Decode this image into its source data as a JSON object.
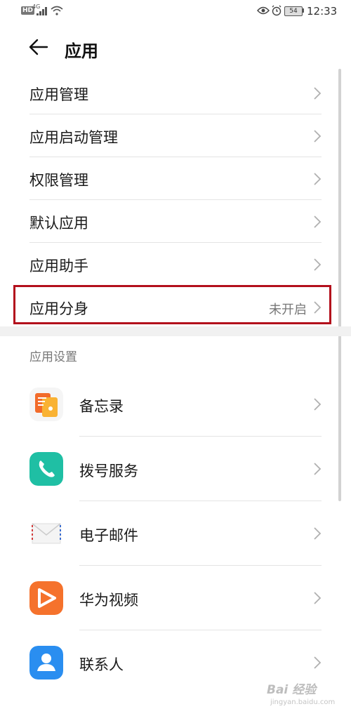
{
  "status": {
    "hd": "HD",
    "network": "4G",
    "battery": "54",
    "time": "12:33"
  },
  "header": {
    "title": "应用"
  },
  "menu": [
    {
      "label": "应用管理",
      "value": ""
    },
    {
      "label": "应用启动管理",
      "value": ""
    },
    {
      "label": "权限管理",
      "value": ""
    },
    {
      "label": "默认应用",
      "value": ""
    },
    {
      "label": "应用助手",
      "value": ""
    },
    {
      "label": "应用分身",
      "value": "未开启"
    }
  ],
  "section_title": "应用设置",
  "apps": [
    {
      "label": "备忘录",
      "icon": "memo-icon"
    },
    {
      "label": "拨号服务",
      "icon": "phone-icon"
    },
    {
      "label": "电子邮件",
      "icon": "email-icon"
    },
    {
      "label": "华为视频",
      "icon": "video-icon"
    },
    {
      "label": "联系人",
      "icon": "contacts-icon"
    }
  ],
  "watermark": {
    "text": "Bai 经验",
    "sub": "jingyan.baidu.com"
  },
  "colors": {
    "highlight": "#b30f1c",
    "phone": "#1fbfa4",
    "video": "#f5722c",
    "contacts": "#2a8ef0"
  }
}
